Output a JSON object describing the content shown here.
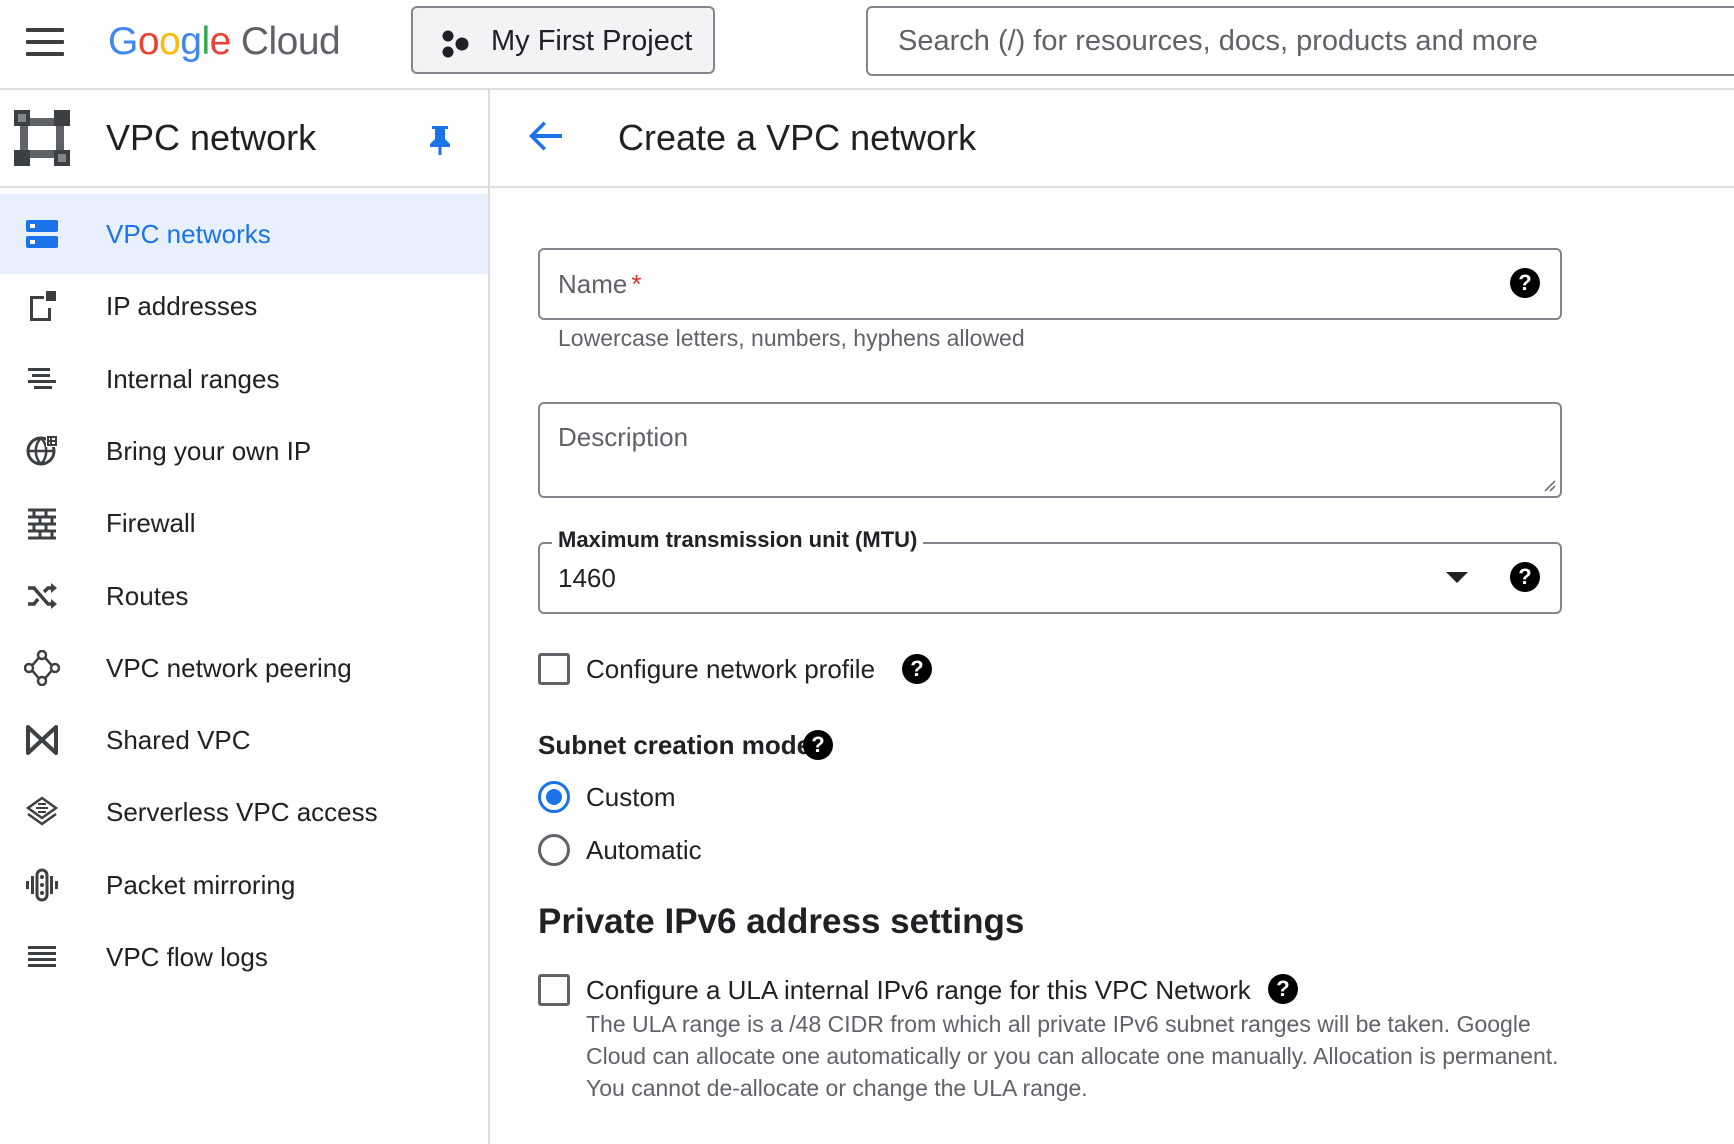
{
  "header": {
    "logo_google": "Google",
    "logo_cloud": "Cloud",
    "project_label": "My First Project",
    "search_placeholder": "Search (/) for resources, docs, products and more"
  },
  "sidebar": {
    "title": "VPC network",
    "items": [
      {
        "label": "VPC networks",
        "icon": "vpc-networks-icon",
        "active": true
      },
      {
        "label": "IP addresses",
        "icon": "ip-addresses-icon"
      },
      {
        "label": "Internal ranges",
        "icon": "internal-ranges-icon"
      },
      {
        "label": "Bring your own IP",
        "icon": "globe-icon"
      },
      {
        "label": "Firewall",
        "icon": "firewall-icon"
      },
      {
        "label": "Routes",
        "icon": "routes-icon"
      },
      {
        "label": "VPC network peering",
        "icon": "peering-icon"
      },
      {
        "label": "Shared VPC",
        "icon": "shared-vpc-icon"
      },
      {
        "label": "Serverless VPC access",
        "icon": "serverless-icon"
      },
      {
        "label": "Packet mirroring",
        "icon": "packet-mirroring-icon"
      },
      {
        "label": "VPC flow logs",
        "icon": "flow-logs-icon"
      }
    ]
  },
  "main": {
    "title": "Create a VPC network",
    "name_label": "Name",
    "name_required": "*",
    "name_value": "",
    "name_hint": "Lowercase letters, numbers, hyphens allowed",
    "description_placeholder": "Description",
    "description_value": "",
    "mtu_label": "Maximum transmission unit (MTU)",
    "mtu_value": "1460",
    "network_profile_label": "Configure network profile",
    "network_profile_checked": false,
    "subnet_mode_heading": "Subnet creation mode",
    "subnet_mode_options": [
      "Custom",
      "Automatic"
    ],
    "subnet_mode_selected": "Custom",
    "ipv6_heading": "Private IPv6 address settings",
    "ula_label": "Configure a ULA internal IPv6 range for this VPC Network",
    "ula_checked": false,
    "ula_description": "The ULA range is a /48 CIDR from which all private IPv6 subnet ranges will be taken. Google Cloud can allocate one automatically or you can allocate one manually. Allocation is permanent. You cannot de-allocate or change the ULA range."
  },
  "colors": {
    "accent": "#1a73e8",
    "active_bg": "#e8f0fe",
    "required": "#d93025",
    "google_blue": "#4285F4",
    "google_red": "#EA4335",
    "google_yellow": "#FBBC05",
    "google_green": "#34A853"
  }
}
